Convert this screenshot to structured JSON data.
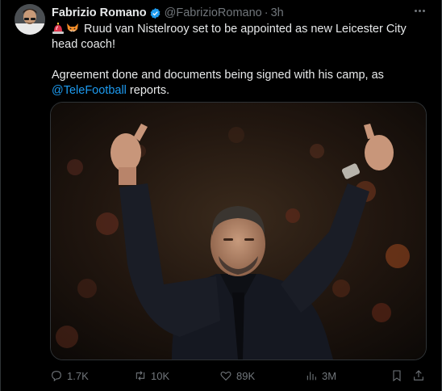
{
  "author": {
    "name": "Fabrizio Romano",
    "handle": "@FabrizioRomano",
    "time": "3h"
  },
  "tweet": {
    "line1": "Ruud van Nistelrooy set to be appointed as new Leicester City head coach!",
    "line2_before": "Agreement done and documents being signed with his camp, as ",
    "mention": "@TeleFootball",
    "line2_after": " reports.",
    "emojis": [
      "siren-emoji",
      "fox-emoji"
    ]
  },
  "stats": {
    "replies": "1.7K",
    "retweets": "10K",
    "likes": "89K",
    "views": "3M"
  },
  "colors": {
    "accent": "#1d9bf0",
    "muted": "#71767b",
    "text": "#e7e9ea",
    "background": "#000000"
  }
}
